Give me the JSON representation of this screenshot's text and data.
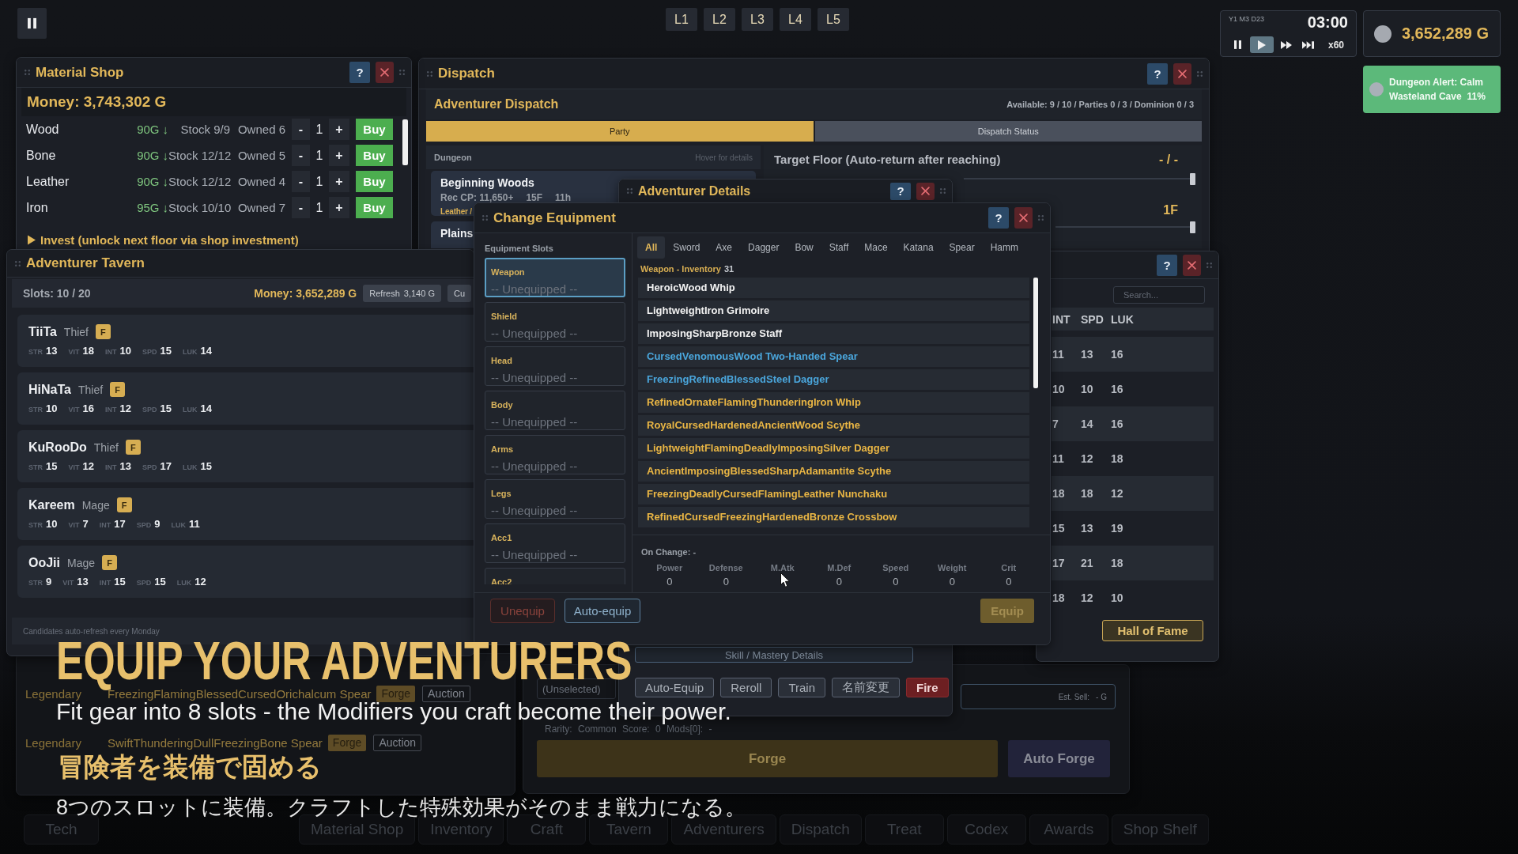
{
  "hud": {
    "levels": [
      "L1",
      "L2",
      "L3",
      "L4",
      "L5"
    ]
  },
  "clock": {
    "date": "Y1 M3 D23",
    "time": "03:00",
    "controls": [
      {
        "kind": "pause",
        "selected": false
      },
      {
        "kind": "play",
        "selected": true
      },
      {
        "kind": "fast_forward",
        "selected": false
      },
      {
        "kind": "skip",
        "selected": false
      }
    ],
    "speed": "x60"
  },
  "wallet": {
    "amount": "3,652,289 G"
  },
  "alert": {
    "title": "Dungeon Alert: Calm",
    "place": "Wasteland Cave",
    "rate": "11%"
  },
  "material_shop": {
    "title": "Material Shop",
    "help": "?",
    "money": "Money: 3,743,302 G",
    "rows": [
      {
        "name": "Wood",
        "price": "90G",
        "trend": "↓",
        "stock": "Stock 9/9",
        "owned": "Owned 6",
        "minus": "-",
        "qty": "1",
        "plus": "+",
        "buy": "Buy"
      },
      {
        "name": "Bone",
        "price": "90G",
        "trend": "↓",
        "stock": "Stock 12/12",
        "owned": "Owned 5",
        "minus": "-",
        "qty": "1",
        "plus": "+",
        "buy": "Buy"
      },
      {
        "name": "Leather",
        "price": "90G",
        "trend": "↓",
        "stock": "Stock 12/12",
        "owned": "Owned 4",
        "minus": "-",
        "qty": "1",
        "plus": "+",
        "buy": "Buy"
      },
      {
        "name": "Iron",
        "price": "95G",
        "trend": "↓",
        "stock": "Stock 10/10",
        "owned": "Owned 7",
        "minus": "-",
        "qty": "1",
        "plus": "+",
        "buy": "Buy"
      }
    ],
    "invest": {
      "label": "Invest (unlock next floor via shop investment)",
      "expanded": false
    }
  },
  "tavern": {
    "title": "Adventurer Tavern",
    "slots": "Slots: 10 / 20",
    "money": "Money: 3,652,289 G",
    "refresh": {
      "label": "Refresh",
      "cost": "3,140 G"
    },
    "button_2": "Cu",
    "candidates": [
      {
        "name": "TiiTa",
        "class": "Thief",
        "rank": "F",
        "stats": [
          {
            "label": "STR",
            "value": "13"
          },
          {
            "label": "VIT",
            "value": "18"
          },
          {
            "label": "INT",
            "value": "10"
          },
          {
            "label": "SPD",
            "value": "15"
          },
          {
            "label": "LUK",
            "value": "14"
          }
        ]
      },
      {
        "name": "HiNaTa",
        "class": "Thief",
        "rank": "F",
        "stats": [
          {
            "label": "STR",
            "value": "10"
          },
          {
            "label": "VIT",
            "value": "16"
          },
          {
            "label": "INT",
            "value": "12"
          },
          {
            "label": "SPD",
            "value": "15"
          },
          {
            "label": "LUK",
            "value": "14"
          }
        ]
      },
      {
        "name": "KuRooDo",
        "class": "Thief",
        "rank": "F",
        "stats": [
          {
            "label": "STR",
            "value": "15"
          },
          {
            "label": "VIT",
            "value": "12"
          },
          {
            "label": "INT",
            "value": "13"
          },
          {
            "label": "SPD",
            "value": "17"
          },
          {
            "label": "LUK",
            "value": "15"
          }
        ]
      },
      {
        "name": "Kareem",
        "class": "Mage",
        "rank": "F",
        "stats": [
          {
            "label": "STR",
            "value": "10"
          },
          {
            "label": "VIT",
            "value": "7"
          },
          {
            "label": "INT",
            "value": "17"
          },
          {
            "label": "SPD",
            "value": "9"
          },
          {
            "label": "LUK",
            "value": "11"
          }
        ]
      },
      {
        "name": "OoJii",
        "class": "Mage",
        "rank": "F",
        "stats": [
          {
            "label": "STR",
            "value": "9"
          },
          {
            "label": "VIT",
            "value": "13"
          },
          {
            "label": "INT",
            "value": "15"
          },
          {
            "label": "SPD",
            "value": "15"
          },
          {
            "label": "LUK",
            "value": "12"
          }
        ]
      }
    ],
    "footer": "Candidates auto-refresh every Monday"
  },
  "dispatch": {
    "title": "Dispatch",
    "help": "?",
    "heading": "Adventurer Dispatch",
    "summary": "Available: 9 / 10 / Parties 0 / 3 / Dominion 0 / 3",
    "tabs": [
      {
        "label": "Party",
        "selected": true
      },
      {
        "label": "Dispatch Status",
        "selected": false
      }
    ],
    "list_header": "Dungeon",
    "hint": "Hover for details",
    "dungeons": [
      {
        "name": "Beginning Woods",
        "rec": "Rec CP: 11,650+",
        "floors": "15F",
        "time": "11h",
        "materials": "Leather /"
      },
      {
        "name": "Plains"
      }
    ],
    "sliders": [
      {
        "label": "Target Floor (Auto-return after reaching)",
        "value": "- / -",
        "level": 1
      },
      {
        "value": "1F",
        "level": 1
      }
    ]
  },
  "adventurers": {
    "help": "?",
    "search": {
      "placeholder": "Search..."
    },
    "columns": [
      "INT",
      "SPD",
      "LUK"
    ],
    "rows": [
      {
        "cells": [
          "11",
          "13",
          "16"
        ]
      },
      {
        "cells": [
          "10",
          "10",
          "16"
        ]
      },
      {
        "cells": [
          "7",
          "14",
          "16"
        ]
      },
      {
        "cells": [
          "11",
          "12",
          "18"
        ]
      },
      {
        "cells": [
          "18",
          "18",
          "12"
        ]
      },
      {
        "cells": [
          "15",
          "13",
          "19"
        ]
      },
      {
        "cells": [
          "17",
          "21",
          "18"
        ]
      },
      {
        "cells": [
          "18",
          "12",
          "10"
        ]
      }
    ],
    "hall_of_fame": "Hall of Fame"
  },
  "adventurer_details": {
    "title": "Adventurer Details",
    "help": "?",
    "skill_button": "Skill / Mastery Details",
    "actions": [
      {
        "label": "Auto-Equip",
        "kind": "normal"
      },
      {
        "label": "Reroll",
        "kind": "normal"
      },
      {
        "label": "Train",
        "kind": "normal"
      },
      {
        "label": "名前変更",
        "kind": "normal"
      },
      {
        "label": "Fire",
        "kind": "danger"
      }
    ]
  },
  "forge": {
    "preview": "(Unselected)",
    "est_sell_label": "Est. Sell:",
    "est_sell_value": "- G",
    "info": "Rarity: Common Score: 0 Mods[0]: -",
    "forge_button": "Forge",
    "auto_forge_button": "Auto Forge"
  },
  "inventory": {
    "rows": [
      {
        "rarity": "Legendary",
        "name": "FreezingFlamingBlessedCursedOrichalcum Spear",
        "forge": "Forge",
        "auction": "Auction"
      },
      {
        "rarity": "Legendary",
        "name": "SwiftThunderingDullFreezingBone Spear",
        "forge": "Forge",
        "auction": "Auction"
      }
    ]
  },
  "change_equipment": {
    "title": "Change Equipment",
    "help": "?",
    "slots_heading": "Equipment Slots",
    "slots": [
      {
        "label": "Weapon",
        "value": "-- Unequipped --",
        "selected": true
      },
      {
        "label": "Shield",
        "value": "-- Unequipped --",
        "selected": false
      },
      {
        "label": "Head",
        "value": "-- Unequipped --",
        "selected": false
      },
      {
        "label": "Body",
        "value": "-- Unequipped --",
        "selected": false
      },
      {
        "label": "Arms",
        "value": "-- Unequipped --",
        "selected": false
      },
      {
        "label": "Legs",
        "value": "-- Unequipped --",
        "selected": false
      },
      {
        "label": "Acc1",
        "value": "-- Unequipped --",
        "selected": false
      },
      {
        "label": "Acc2",
        "selected": false
      }
    ],
    "filters": [
      {
        "label": "All",
        "selected": true
      },
      {
        "label": "Sword",
        "selected": false
      },
      {
        "label": "Axe",
        "selected": false
      },
      {
        "label": "Dagger",
        "selected": false
      },
      {
        "label": "Bow",
        "selected": false
      },
      {
        "label": "Staff",
        "selected": false
      },
      {
        "label": "Mace",
        "selected": false
      },
      {
        "label": "Katana",
        "selected": false
      },
      {
        "label": "Spear",
        "selected": false
      },
      {
        "label": "Hamm",
        "selected": false
      }
    ],
    "list_heading": "Weapon - Inventory",
    "count": "31",
    "items": [
      {
        "name": "HeroicWood Whip",
        "color": "#f2f2f2"
      },
      {
        "name": "LightweightIron Grimoire",
        "color": "#f2f2f2"
      },
      {
        "name": "ImposingSharpBronze Staff",
        "color": "#f2f2f2"
      },
      {
        "name": "CursedVenomousWood Two-Handed Spear",
        "color": "#4aa6dc"
      },
      {
        "name": "FreezingRefinedBlessedSteel Dagger",
        "color": "#4aa6dc"
      },
      {
        "name": "RefinedOrnateFlamingThunderingIron Whip",
        "color": "#eab644"
      },
      {
        "name": "RoyalCursedHardenedAncientWood Scythe",
        "color": "#eab644"
      },
      {
        "name": "LightweightFlamingDeadlyImposingSilver Dagger",
        "color": "#eab644"
      },
      {
        "name": "AncientImposingBlessedSharpAdamantite Scythe",
        "color": "#eab644"
      },
      {
        "name": "FreezingDeadlyCursedFlamingLeather Nunchaku",
        "color": "#eab644"
      },
      {
        "name": "RefinedCursedFreezingHardenedBronze Crossbow",
        "color": "#eab644"
      }
    ],
    "on_change": "On Change: -",
    "stats": [
      {
        "label": "Power",
        "value": "0"
      },
      {
        "label": "Defense",
        "value": "0"
      },
      {
        "label": "M.Atk"
      },
      {
        "label": "M.Def",
        "value": "0"
      },
      {
        "label": "Speed",
        "value": "0"
      },
      {
        "label": "Weight",
        "value": "0"
      },
      {
        "label": "Crit",
        "value": "0"
      }
    ],
    "unequip": {
      "label": "Unequip",
      "disabled": true
    },
    "auto_equip": "Auto-equip",
    "equip": {
      "label": "Equip",
      "disabled": true
    }
  },
  "taskbar": [
    "Tech",
    "Material Shop",
    "Inventory",
    "Craft",
    "Tavern",
    "Adventurers",
    "Dispatch",
    "Treat",
    "Codex",
    "Awards",
    "Shop Shelf"
  ],
  "caption": {
    "title": "EQUIP YOUR ADVENTURERS",
    "subtitle": "Fit gear into 8 slots - the Modifiers you craft become their power.",
    "title_ja": "冒険者を装備で固める",
    "subtitle_ja": "8つのスロットに装備。クラフトした特殊効果がそのまま戦力になる。"
  }
}
